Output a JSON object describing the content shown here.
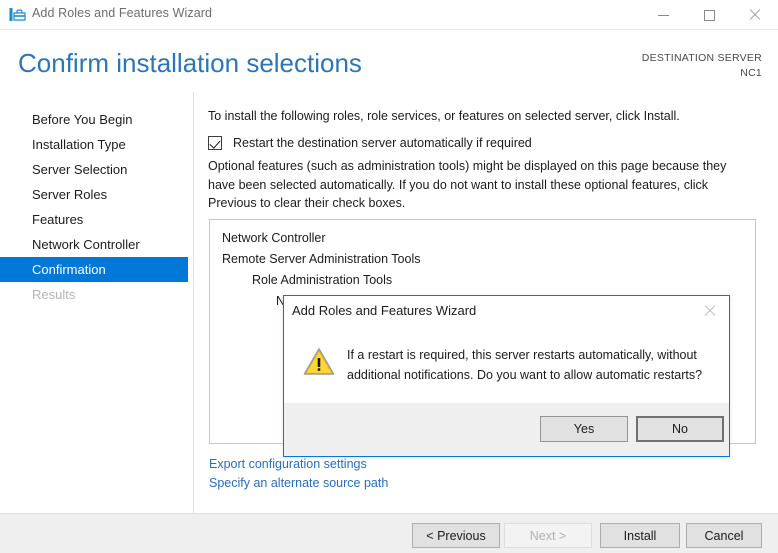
{
  "window": {
    "title": "Add Roles and Features Wizard",
    "icon": "wizard-toolbox-icon",
    "minimize_label": "Minimize",
    "maximize_label": "Maximize",
    "close_label": "Close"
  },
  "header": {
    "page_title": "Confirm installation selections",
    "destination_label": "DESTINATION SERVER",
    "destination_value": "NC1",
    "accent_color": "#2e75b6"
  },
  "sidebar": {
    "items": [
      {
        "label": "Before You Begin",
        "state": "normal"
      },
      {
        "label": "Installation Type",
        "state": "normal"
      },
      {
        "label": "Server Selection",
        "state": "normal"
      },
      {
        "label": "Server Roles",
        "state": "normal"
      },
      {
        "label": "Features",
        "state": "normal"
      },
      {
        "label": "Network Controller",
        "state": "normal"
      },
      {
        "label": "Confirmation",
        "state": "active"
      },
      {
        "label": "Results",
        "state": "disabled"
      }
    ],
    "active_color": "#0078d7"
  },
  "main": {
    "intro_text": "To install the following roles, role services, or features on selected server, click Install.",
    "restart_checkbox": {
      "label": "Restart the destination server automatically if required",
      "checked": true
    },
    "optional_text": "Optional features (such as administration tools) might be displayed on this page because they have been selected automatically. If you do not want to install these optional features, click Previous to clear their check boxes.",
    "selection_list": [
      {
        "label": "Network Controller",
        "indent": 0
      },
      {
        "label": "Remote Server Administration Tools",
        "indent": 0
      },
      {
        "label": "Role Administration Tools",
        "indent": 1
      },
      {
        "label": "Network Controller Management Tools",
        "indent": 2
      }
    ],
    "links": [
      {
        "label": "Export configuration settings"
      },
      {
        "label": "Specify an alternate source path"
      }
    ],
    "link_color": "#2a6eb8"
  },
  "footer": {
    "previous_label": "< Previous",
    "next_label": "Next >",
    "next_disabled": true,
    "install_label": "Install",
    "cancel_label": "Cancel"
  },
  "dialog": {
    "title": "Add Roles and Features Wizard",
    "close_label": "Close",
    "icon": "warning-triangle-icon",
    "message": "If a restart is required, this server restarts automatically, without additional notifications. Do you want to allow automatic restarts?",
    "yes_label": "Yes",
    "no_label": "No",
    "default_button": "No",
    "border_color": "#0078d7",
    "warning_color": "#ffc20e"
  }
}
